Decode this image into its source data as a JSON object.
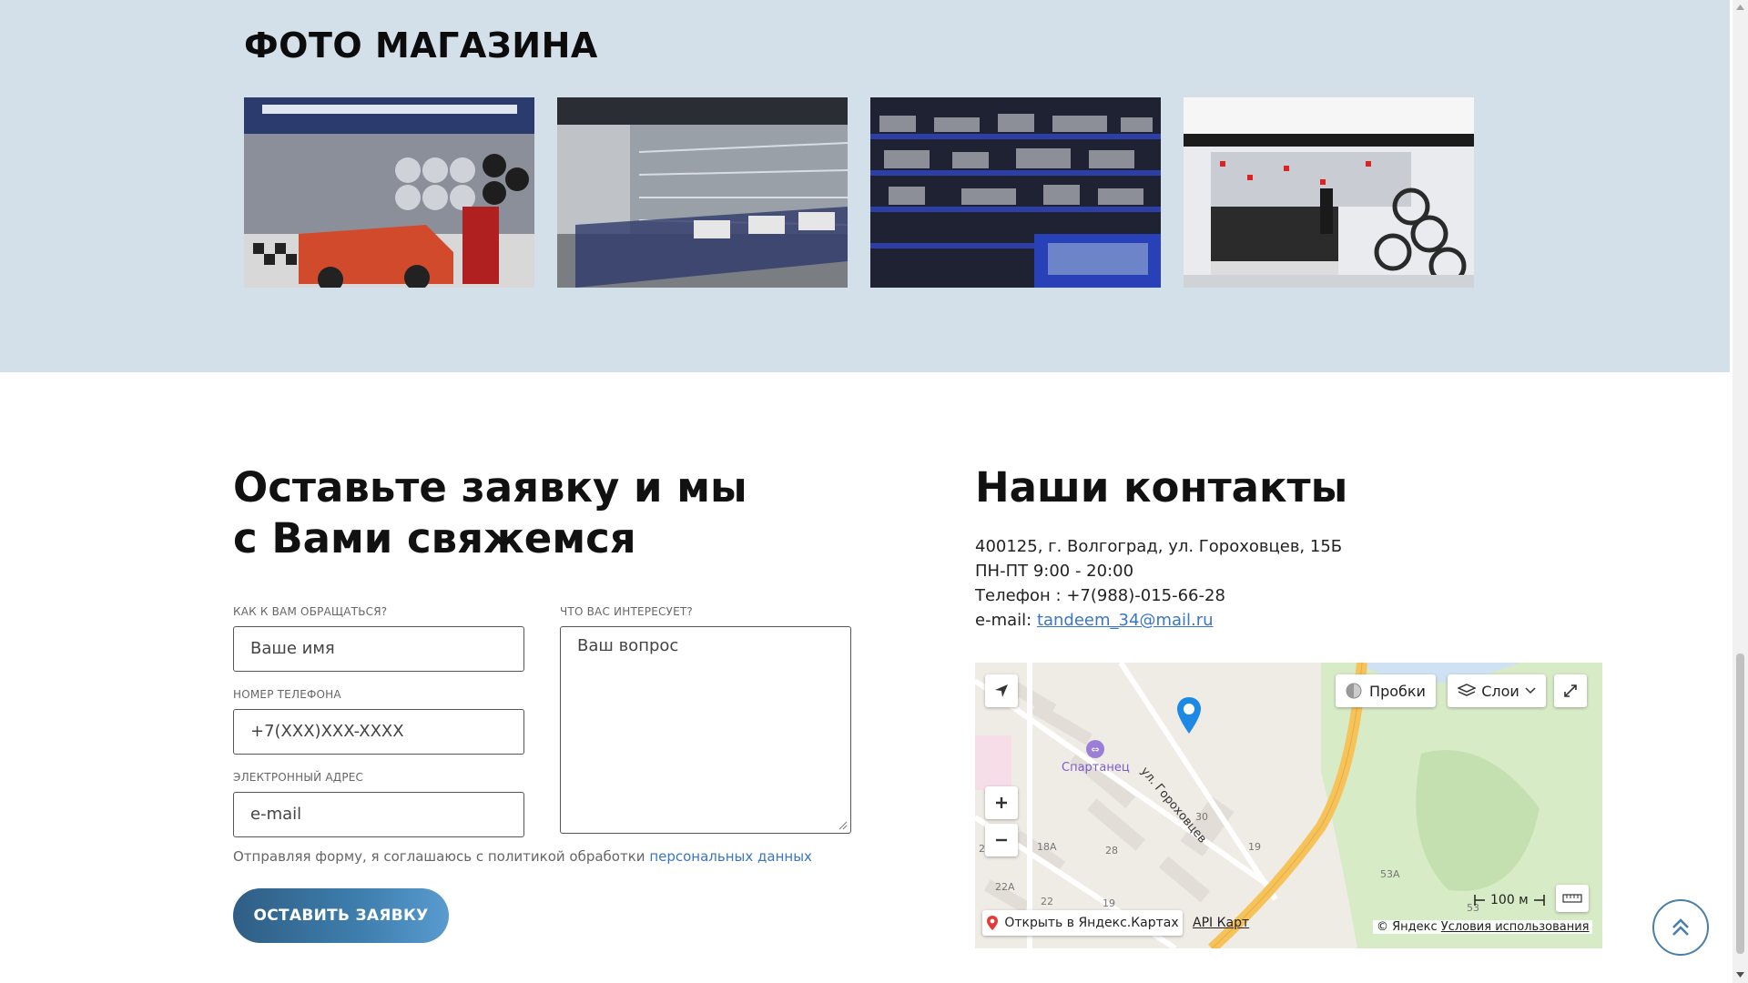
{
  "photos": {
    "title": "ФОТО МАГАЗИНА"
  },
  "form": {
    "title_line1": "Оставьте заявку и мы",
    "title_line2": "с Вами свяжемся",
    "name_label": "КАК К ВАМ ОБРАЩАТЬСЯ?",
    "name_placeholder": "Ваше имя",
    "phone_label": "НОМЕР ТЕЛЕФОНА",
    "phone_placeholder": "+7(XXX)XXX-XXXX",
    "email_label": "ЭЛЕКТРОННЫЙ АДРЕС",
    "email_placeholder": "e-mail",
    "question_label": "ЧТО ВАС ИНТЕРЕСУЕТ?",
    "question_placeholder": "Ваш вопрос",
    "consent_text": "Отправляя форму, я соглашаюсь с политикой обработки",
    "consent_link": "персональных данных",
    "submit_label": "ОСТАВИТЬ ЗАЯВКУ"
  },
  "contacts": {
    "title": "Наши контакты",
    "address": "400125, г. Волгоград, ул. Гороховцев, 15Б",
    "hours": "ПН-ПТ 9:00 - 20:00",
    "phone": "Телефон : +7(988)-015-66-28",
    "email_prefix": "e-mail:",
    "email": "tandeem_34@mail.ru"
  },
  "map": {
    "traffic_label": "Пробки",
    "layers_label": "Слои",
    "poi_label": "Спартанец",
    "street_label": "ул. Гороховцев",
    "house_numbers": [
      "30",
      "28",
      "19",
      "18А",
      "22А",
      "22",
      "19",
      "53А",
      "53",
      "2"
    ],
    "scale_label": "100 м",
    "open_label": "Открыть в Яндекс.Картах",
    "api_label": "API Карт",
    "copyright": "© Яндекс",
    "terms_label": "Условия использования",
    "pin_color": "#1e88e5",
    "road_color": "#f6c35b"
  },
  "colors": {
    "photo_bg": "#d3e0ea",
    "link": "#3a76c4",
    "button": "#2f5e85"
  }
}
